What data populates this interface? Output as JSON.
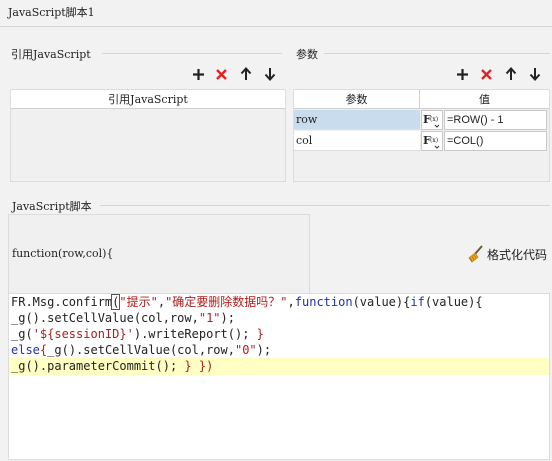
{
  "window": {
    "title": "JavaScript脚本1"
  },
  "ref_section": {
    "label": "引用JavaScript",
    "table_header": "引用JavaScript",
    "rows": []
  },
  "param_section": {
    "label": "参数",
    "columns": [
      "参数",
      "值"
    ],
    "rows": [
      {
        "name": "row",
        "value": "=ROW() - 1",
        "selected": true
      },
      {
        "name": "col",
        "value": "=COL()",
        "selected": false
      }
    ]
  },
  "script_section": {
    "label": "JavaScript脚本",
    "signature": "function(row,col){",
    "format_button": "格式化代码"
  },
  "code": {
    "line1": {
      "a": "FR.Msg.confirm",
      "b": "(",
      "c": "\"提示\"",
      "d": ",",
      "e": "\"确定要删除数据吗？\"",
      "f": ",",
      "g": "function",
      "h": "(value){",
      "i": "if",
      "j": "(value){"
    },
    "line2": {
      "a": "_g().setCellValue(col,row,",
      "b": "\"1\"",
      "c": ");"
    },
    "line3": {
      "a": "_g(",
      "b": "'${sessionID}'",
      "c": ").writeReport(); ",
      "d": "}"
    },
    "line4": {
      "a": "else",
      "b": "{",
      "c": "_g().setCellValue(col,row,",
      "d": "\"0\"",
      "e": ");"
    },
    "line5": {
      "a": "_g().parameterCommit(); ",
      "b": "} })"
    }
  },
  "colors": {
    "keyword": "#1f2fb0",
    "string": "#b01b1b",
    "selected_row": "#c8dced",
    "highlight_line": "#ffffc4",
    "delete_red": "#e02424"
  },
  "icons": [
    "add-icon",
    "delete-icon",
    "move-up-icon",
    "move-down-icon",
    "formula-icon",
    "broom-icon"
  ]
}
